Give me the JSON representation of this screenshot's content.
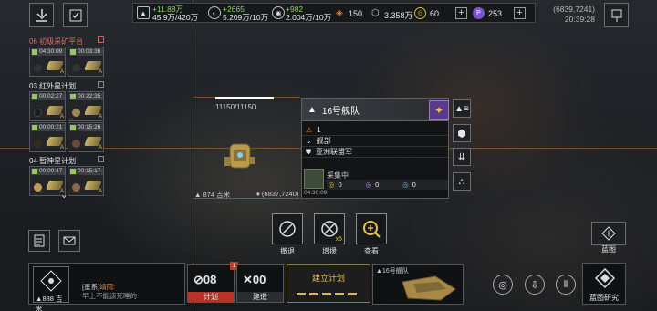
{
  "top": {
    "res1": {
      "gain": "+11.88万",
      "value": "45.9万/420万"
    },
    "res2": {
      "gain": "+2665",
      "value": "5.209万/10万"
    },
    "res3": {
      "gain": "+982",
      "value": "2.004万/10万"
    },
    "res4": "150",
    "res5": "3.358万",
    "res6": "60",
    "res7": "253",
    "coords": "(6839,7241)",
    "clock": "20:39:28"
  },
  "left_list": {
    "group1": {
      "title": "06 初级采矿平台",
      "times": [
        "04:30:09",
        "00:03:36"
      ]
    },
    "group2": {
      "title": "03 红外星计划",
      "times": [
        "00:02:27",
        "00:22:35",
        "00:00:21",
        "00:15:26"
      ]
    },
    "group3": {
      "title": "04 暂神星计划",
      "times": [
        "00:00:47",
        "00:15:17"
      ]
    }
  },
  "target": {
    "hp": "11150/11150",
    "distance": "874 吉米",
    "position": "(6837,7240)"
  },
  "panel": {
    "fleet_name": "16号舰队",
    "level": "1",
    "state": "舰部",
    "faction": "亚洲联盟军",
    "task": "采集中",
    "timer": "04:30:09",
    "cargo": [
      "0",
      "0",
      "0"
    ]
  },
  "actions": {
    "withdraw": "撤退",
    "reinforce": "增援",
    "reinforce_badge": "x5",
    "view": "查看"
  },
  "right": {
    "blueprint": "蓝图",
    "blueprint_research": "蓝图研究"
  },
  "bottom": {
    "distance": "888 吉米",
    "chat_channel": "[星系]",
    "chat_user": "靖雨:",
    "chat_text": "早上不能该死睡的",
    "plan_count": "08",
    "plan_label": "计划",
    "plan_badge": "1",
    "build_count": "00",
    "build_label": "建造",
    "create_plan": "建立计划",
    "fleet_card": "16号舰队"
  }
}
